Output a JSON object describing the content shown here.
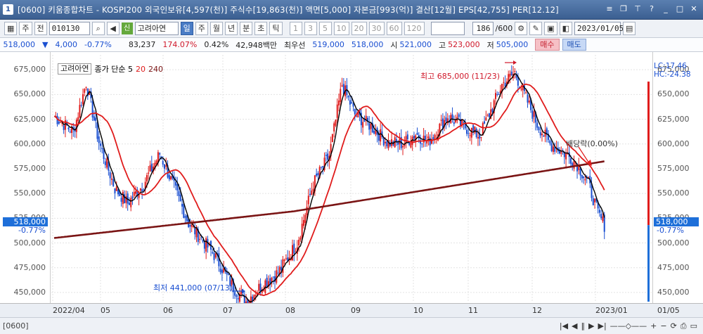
{
  "window": {
    "title": "[0600] 키움종합차트 - KOSPI200 외국인보유[4,597(천)] 주식수[19,863(천)] 액면[5,000] 자본금[993(억)] 결산[12월] EPS[42,755] PER[12.12]",
    "icon_label": "1"
  },
  "toolbar": {
    "type_label": "주",
    "period_label": "전",
    "stock_code": "010130",
    "stock_name": "고려아연",
    "tab_labels": [
      "일",
      "주",
      "월",
      "년",
      "분",
      "초",
      "틱"
    ],
    "interval_labels": [
      "1",
      "3",
      "5",
      "10",
      "20",
      "30",
      "60",
      "120"
    ],
    "count_value": "186",
    "count_total": "/600",
    "date_value": "2023/01/05"
  },
  "info": {
    "price": "518,000",
    "change_arrow": "▼",
    "change": "4,000",
    "change_pct": "-0.77%",
    "volume": "83,237",
    "volume_ratio": "174.07%",
    "turnover_pct": "0.42%",
    "amount": "42,948백만",
    "best_ask_label": "최우선",
    "best_ask": "519,000",
    "best_bid": "518,000",
    "open_label": "시",
    "open": "521,000",
    "high_label": "고",
    "high": "523,000",
    "low_label": "저",
    "low": "505,000",
    "buy_label": "매수",
    "sell_label": "매도"
  },
  "legend": {
    "stock": "고려아연",
    "ma_prefix": "종가 단순 5",
    "ma20": "20",
    "ma240": "240"
  },
  "annotations": {
    "high": "최고 685,000 (11/23)",
    "low": "최저 441,000 (07/13)",
    "dividend": "배당락(0.00%)",
    "lc": "LC:17.46",
    "hc": "HC:-24.38",
    "left_price": "518,000",
    "left_pct": "-0.77%",
    "right_price": "518,000",
    "right_pct": "-0.77%"
  },
  "chart_data": {
    "type": "candlestick",
    "y_ticks": [
      "675,000",
      "650,000",
      "625,000",
      "600,000",
      "575,000",
      "550,000",
      "525,000",
      "500,000",
      "475,000",
      "450,000"
    ],
    "ylim": [
      440000,
      690000
    ],
    "x_ticks": [
      "2022/04",
      "05",
      "06",
      "07",
      "08",
      "09",
      "10",
      "11",
      "12",
      "2023/01",
      "01/05"
    ],
    "series": [
      {
        "name": "5",
        "color": "#000000"
      },
      {
        "name": "20",
        "color": "#e01c1c"
      },
      {
        "name": "240",
        "color": "#7a1414"
      }
    ],
    "highest": {
      "value": 685000,
      "date": "11/23"
    },
    "lowest": {
      "value": 441000,
      "date": "07/13"
    },
    "last_close": 518000
  },
  "status": {
    "screen_code": "[0600]"
  },
  "colors": {
    "up": "#e01c1c",
    "down": "#1a4fd1",
    "accent": "#1e6fd9"
  }
}
